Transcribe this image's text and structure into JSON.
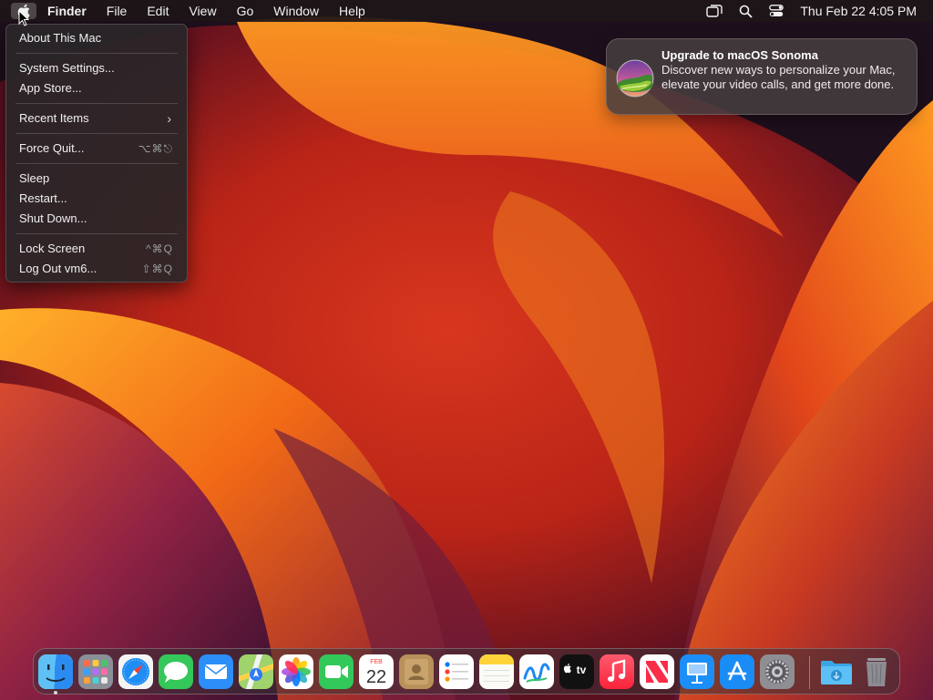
{
  "menubar": {
    "apple_icon": "apple-logo-icon",
    "app_name": "Finder",
    "menus": [
      "File",
      "Edit",
      "View",
      "Go",
      "Window",
      "Help"
    ],
    "status_icons": [
      "screen-mirroring-icon",
      "spotlight-search-icon",
      "control-center-icon"
    ],
    "clock": "Thu Feb 22  4:05 PM"
  },
  "apple_menu": {
    "items": [
      {
        "label": "About This Mac"
      },
      {
        "label": "System Settings..."
      },
      {
        "label": "App Store..."
      },
      {
        "label": "Recent Items",
        "submenu": true
      },
      {
        "label": "Force Quit...",
        "shortcut": "⌥⌘⎋"
      },
      {
        "label": "Sleep"
      },
      {
        "label": "Restart..."
      },
      {
        "label": "Shut Down..."
      },
      {
        "label": "Lock Screen",
        "shortcut": "^⌘Q"
      },
      {
        "label": "Log Out vm6...",
        "shortcut": "⇧⌘Q"
      }
    ]
  },
  "notification": {
    "title": "Upgrade to macOS Sonoma",
    "body": "Discover new ways to personalize your Mac, elevate your video calls, and get more done.",
    "icon": "macos-sonoma-icon"
  },
  "dock": {
    "apps": [
      {
        "name": "Finder",
        "icon": "finder-icon",
        "running": true
      },
      {
        "name": "Launchpad",
        "icon": "launchpad-icon"
      },
      {
        "name": "Safari",
        "icon": "safari-icon"
      },
      {
        "name": "Messages",
        "icon": "messages-icon"
      },
      {
        "name": "Mail",
        "icon": "mail-icon"
      },
      {
        "name": "Maps",
        "icon": "maps-icon"
      },
      {
        "name": "Photos",
        "icon": "photos-icon"
      },
      {
        "name": "FaceTime",
        "icon": "facetime-icon"
      },
      {
        "name": "Calendar",
        "icon": "calendar-icon",
        "month": "FEB",
        "day": "22"
      },
      {
        "name": "Contacts",
        "icon": "contacts-icon"
      },
      {
        "name": "Reminders",
        "icon": "reminders-icon"
      },
      {
        "name": "Notes",
        "icon": "notes-icon"
      },
      {
        "name": "Freeform",
        "icon": "freeform-icon"
      },
      {
        "name": "TV",
        "icon": "apple-tv-icon",
        "label": "tv"
      },
      {
        "name": "Music",
        "icon": "music-icon"
      },
      {
        "name": "News",
        "icon": "news-icon"
      },
      {
        "name": "Keynote",
        "icon": "keynote-icon"
      },
      {
        "name": "App Store",
        "icon": "app-store-icon"
      },
      {
        "name": "System Settings",
        "icon": "system-settings-icon"
      },
      {
        "name": "Downloads",
        "icon": "downloads-folder-icon"
      },
      {
        "name": "Trash",
        "icon": "trash-icon"
      }
    ]
  },
  "colors": {
    "wallpaper_orange": "#ff8a1a",
    "wallpaper_red": "#c8281c",
    "wallpaper_magenta": "#7a1e46",
    "menu_bg": "#2a2628"
  }
}
